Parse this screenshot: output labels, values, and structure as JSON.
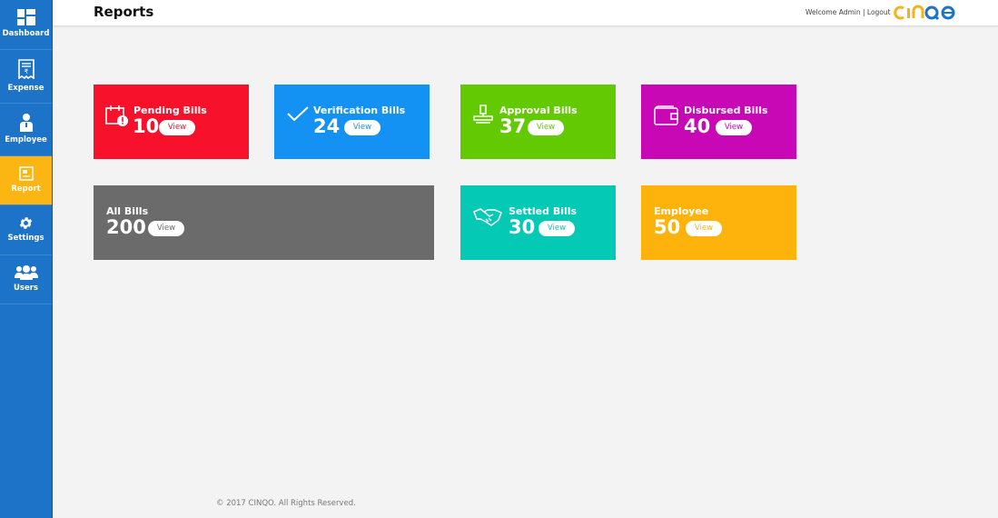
{
  "sidebar": {
    "items": [
      {
        "label": "Dashboard",
        "icon": "dashboard-icon"
      },
      {
        "label": "Expense",
        "icon": "receipt-icon"
      },
      {
        "label": "Employee",
        "icon": "employee-icon"
      },
      {
        "label": "Report",
        "icon": "report-icon"
      },
      {
        "label": "Settings",
        "icon": "gear-icon"
      },
      {
        "label": "Users",
        "icon": "users-icon"
      }
    ],
    "active": "Report"
  },
  "header": {
    "title": "Reports",
    "welcome": "Welcome Admin",
    "separator": "|",
    "logout": "Logout",
    "logo_text": "CINQO"
  },
  "cards": {
    "pending": {
      "title": "Pending Bills",
      "count": "10",
      "view": "View",
      "color": "#f8112a",
      "icon": "calendar-alert-icon"
    },
    "verification": {
      "title": "Verification Bills",
      "count": "24",
      "view": "View",
      "color": "#1492f3",
      "icon": "checkmark-icon"
    },
    "approval": {
      "title": "Approval Bills",
      "count": "37",
      "view": "View",
      "color": "#62c903",
      "icon": "stamp-icon"
    },
    "disbursed": {
      "title": "Disbursed Bills",
      "count": "40",
      "view": "View",
      "color": "#c807b5",
      "icon": "wallet-icon"
    },
    "all": {
      "title": "All Bills",
      "count": "200",
      "view": "View",
      "color": "#6b6b6b"
    },
    "settled": {
      "title": "Settled Bills",
      "count": "30",
      "view": "View",
      "color": "#04c9b5",
      "icon": "handshake-icon"
    },
    "employee": {
      "title": "Employee",
      "count": "50",
      "view": "View",
      "color": "#fdb30c"
    }
  },
  "footer": {
    "text": "© 2017 CINQO. All Rights Reserved."
  }
}
